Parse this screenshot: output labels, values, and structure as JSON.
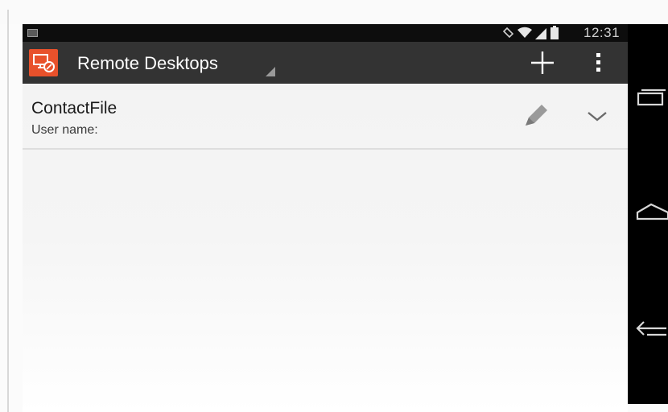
{
  "status_bar": {
    "time": "12:31",
    "icons": [
      "image-notification-icon",
      "rotate-icon",
      "wifi-icon",
      "signal-icon",
      "battery-icon"
    ]
  },
  "app_bar": {
    "title": "Remote Desktops",
    "actions": [
      {
        "name": "add-connection-button",
        "icon": "plus-icon"
      },
      {
        "name": "overflow-menu-button",
        "icon": "more-vert-icon"
      }
    ]
  },
  "desktops": [
    {
      "name": "ContactFile",
      "subtitle": "User name:"
    }
  ],
  "nav_bar": {
    "buttons": [
      "recents-icon",
      "home-icon",
      "back-icon"
    ]
  },
  "colors": {
    "app_bar": "#333333",
    "status_bar": "#0d0d0d",
    "accent": "#e8512b",
    "list_bg": "#f2f2f2",
    "nav_bar": "#000000"
  }
}
